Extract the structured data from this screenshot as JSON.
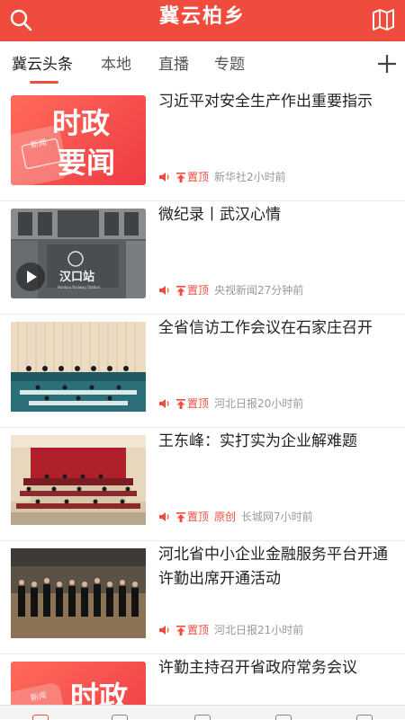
{
  "header": {
    "title": "冀云柏乡",
    "search_icon": "search-icon",
    "map_icon": "map-icon"
  },
  "tabs": [
    {
      "label": "冀云头条",
      "active": true
    },
    {
      "label": "本地",
      "active": false
    },
    {
      "label": "直播",
      "active": false
    },
    {
      "label": "专题",
      "active": false
    }
  ],
  "colors": {
    "brand": "#f04c3e"
  },
  "news": [
    {
      "title": "习近平对安全生产作出重要指示",
      "pin": "置顶",
      "original": "",
      "source": "新华社2小时前",
      "thumb": "red-card",
      "thumb_text": [
        "时政",
        "要闻"
      ],
      "thumb_small": "新闻"
    },
    {
      "title": "微纪录丨武汉心情",
      "pin": "置顶",
      "original": "",
      "source": "央视新闻27分钟前",
      "thumb": "station",
      "thumb_text": [
        "汉口站",
        "Hankou Railway Station"
      ],
      "has_video": true
    },
    {
      "title": "全省信访工作会议在石家庄召开",
      "pin": "置顶",
      "original": "",
      "source": "河北日报20小时前",
      "thumb": "meeting-beige"
    },
    {
      "title": "王东峰：实打实为企业解难题",
      "pin": "置顶",
      "original": "原创",
      "source": "长城网7小时前",
      "thumb": "meeting-red"
    },
    {
      "title": "河北省中小企业金融服务平台开通 许勤出席开通活动",
      "pin": "置顶",
      "original": "",
      "source": "河北日报21小时前",
      "thumb": "meeting-dark"
    },
    {
      "title": "许勤主持召开省政府常务会议",
      "pin": "",
      "original": "",
      "source": "",
      "thumb": "red-card-partial",
      "thumb_text": [
        "时政"
      ],
      "thumb_small": "新闻"
    }
  ]
}
